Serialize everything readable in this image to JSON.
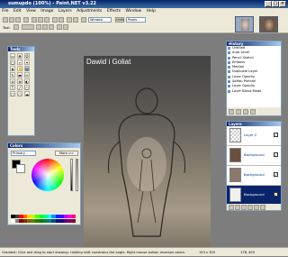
{
  "window": {
    "title": "sumupdo (100%) - Paint.NET v3.22",
    "min": "_",
    "max": "□",
    "close": "✕"
  },
  "menu": [
    "File",
    "Edit",
    "View",
    "Image",
    "Layers",
    "Adjustments",
    "Effects",
    "Window",
    "Help"
  ],
  "toolbar": {
    "tool_label": "Tool:",
    "zoom_label": "Window",
    "zoom_value": "Pixels"
  },
  "tools_panel": {
    "title": "Tools"
  },
  "colors_panel": {
    "title": "Colors",
    "mode": "Primary",
    "more_label": "More >>"
  },
  "history_panel": {
    "title": "History",
    "items": [
      "Untitled",
      "Auto Level",
      "Pencil Sketch",
      "Emboss",
      "Median",
      "Duplicate Layer",
      "Layer Opacity",
      "Soften Portrait",
      "Layer Opacity",
      "Layer Blend Mode"
    ]
  },
  "layers_panel": {
    "title": "Layers",
    "layers": [
      {
        "name": "Layer 2",
        "checked": "✓",
        "selected": false
      },
      {
        "name": "Background",
        "checked": "✓",
        "selected": false
      },
      {
        "name": "Background",
        "checked": "✓",
        "selected": false
      },
      {
        "name": "Background",
        "checked": "✓",
        "selected": true
      }
    ]
  },
  "image": {
    "caption": "Dawid i Goliat"
  },
  "status": {
    "hint": "Gradient: Click and drag to start drawing. Holding shift constrains the angle. Right mouse button reverses colors.",
    "size": "153 x 305",
    "coords": "178, 493"
  },
  "palette": [
    "#000000",
    "#404040",
    "#ff0000",
    "#ff6a00",
    "#ffd800",
    "#b6ff00",
    "#4cff00",
    "#00ff21",
    "#00ff90",
    "#00ffff",
    "#0094ff",
    "#0026ff",
    "#4800ff",
    "#b200ff",
    "#ff00dc",
    "#ff006e",
    "#ffffff",
    "#808080",
    "#7f0000",
    "#7f3300",
    "#7f6a00",
    "#5b7f00",
    "#267f00",
    "#007f0e",
    "#007f46",
    "#007f7f",
    "#004a7f",
    "#00137f",
    "#21007f",
    "#57007f",
    "#7f006e",
    "#7f0037"
  ]
}
